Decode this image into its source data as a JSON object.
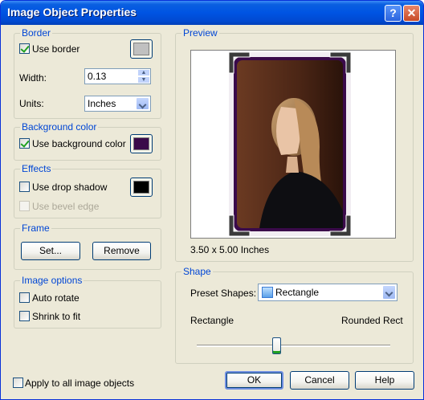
{
  "window": {
    "title": "Image Object Properties",
    "help_glyph": "?",
    "close_glyph": "✕"
  },
  "border": {
    "legend": "Border",
    "use_border_label": "Use border",
    "use_border_checked": true,
    "border_color": "#c0c0c0",
    "width_label": "Width:",
    "width_value": "0.13",
    "units_label": "Units:",
    "units_value": "Inches"
  },
  "background": {
    "legend": "Background color",
    "use_bg_label": "Use background color",
    "use_bg_checked": true,
    "bg_color": "#3a0a4a"
  },
  "effects": {
    "legend": "Effects",
    "drop_shadow_label": "Use drop shadow",
    "drop_shadow_checked": false,
    "shadow_color": "#000000",
    "bevel_label": "Use bevel edge",
    "bevel_enabled": false
  },
  "frame": {
    "legend": "Frame",
    "set_label": "Set...",
    "remove_label": "Remove"
  },
  "image_options": {
    "legend": "Image options",
    "auto_rotate_label": "Auto rotate",
    "shrink_label": "Shrink to fit"
  },
  "apply_all_label": "Apply to all image objects",
  "preview": {
    "legend": "Preview",
    "size_text": "3.50 x 5.00 Inches"
  },
  "shape": {
    "legend": "Shape",
    "preset_label": "Preset Shapes:",
    "preset_value": "Rectangle",
    "left_label": "Rectangle",
    "right_label": "Rounded Rect",
    "slider_fraction": 0.41
  },
  "buttons": {
    "ok": "OK",
    "cancel": "Cancel",
    "help": "Help"
  },
  "colors": {
    "accent": "#0046d5",
    "dialog_bg": "#ece9d8",
    "title_bar": "#0054e3"
  }
}
